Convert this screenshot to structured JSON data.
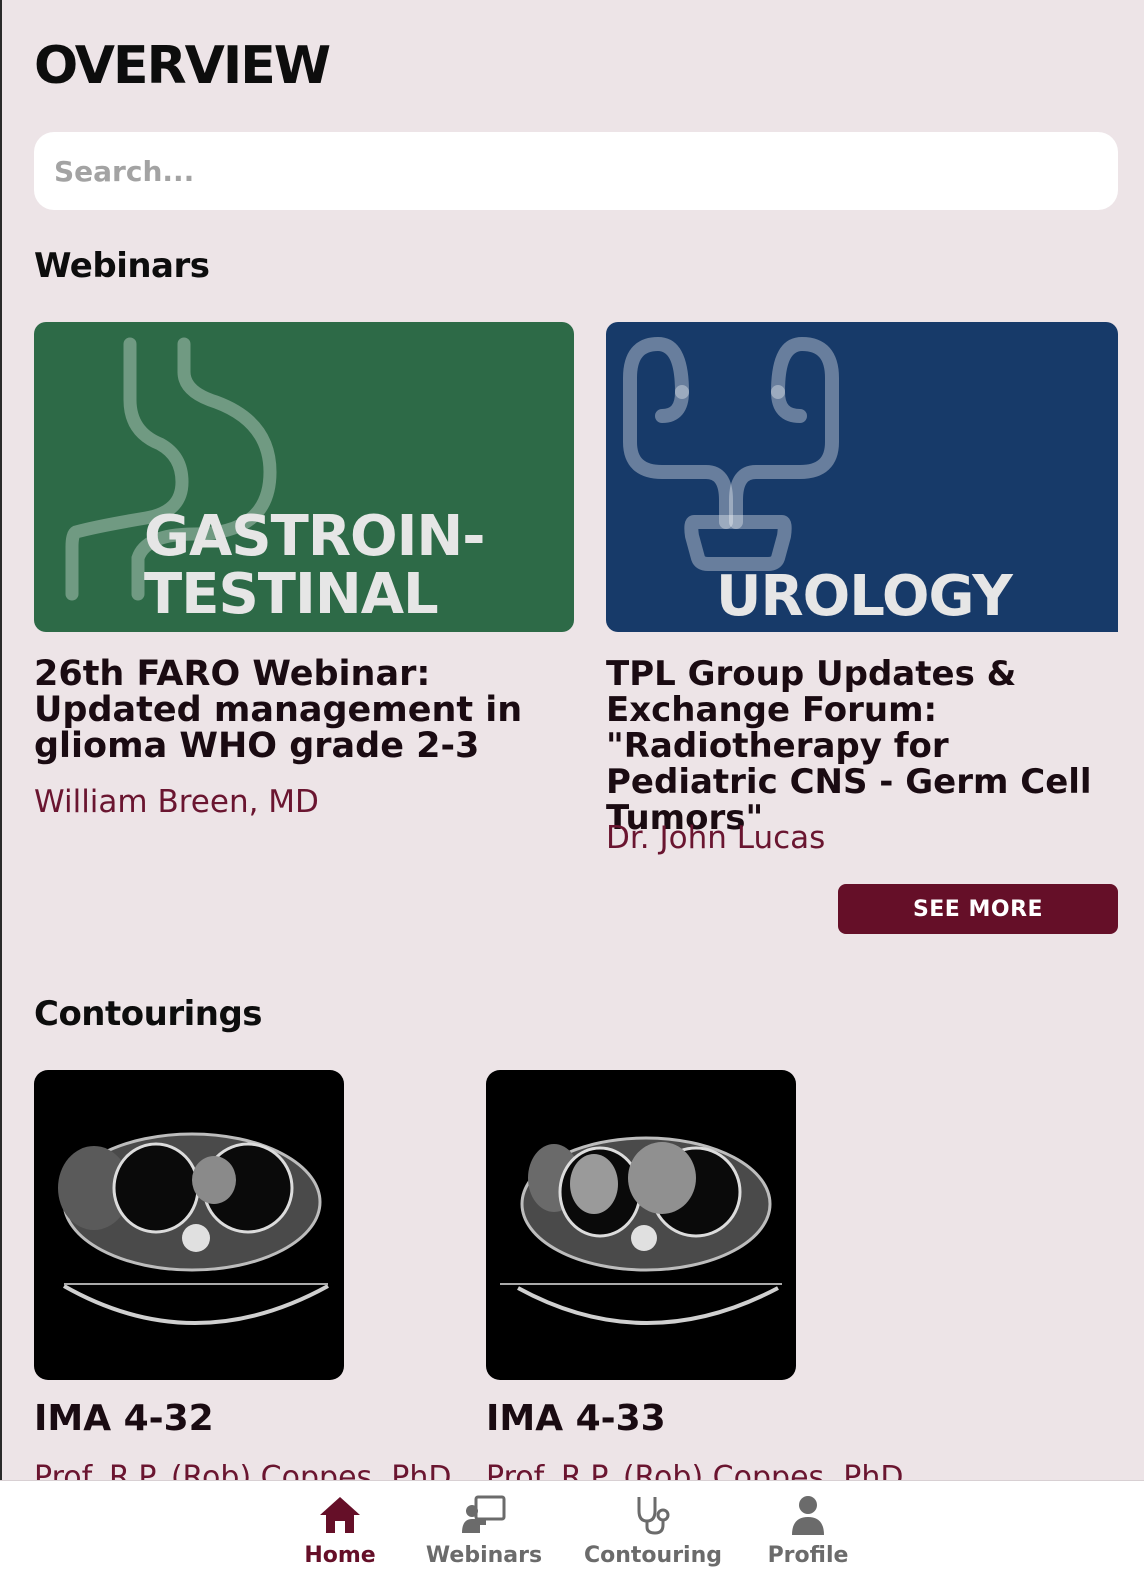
{
  "page": {
    "title": "OVERVIEW"
  },
  "search": {
    "placeholder": "Search..."
  },
  "webinars": {
    "section_title": "Webinars",
    "items": [
      {
        "banner_lines": [
          "GASTROIN-",
          "TESTINAL"
        ],
        "title": "26th FARO Webinar: Updated management in glioma WHO grade 2-3",
        "author": "William Breen, MD"
      },
      {
        "banner_lines": [
          "UROLOGY"
        ],
        "title": "TPL Group Updates & Exchange Forum: \"Radiotherapy for Pediatric CNS - Germ Cell Tumors\"",
        "author": "Dr. John Lucas"
      }
    ],
    "see_more_label": "SEE MORE"
  },
  "contourings": {
    "section_title": "Contourings",
    "items": [
      {
        "title": "IMA 4-32",
        "author": "Prof. R.P. (Rob) Coppes, PhD"
      },
      {
        "title": "IMA 4-33",
        "author": "Prof. R.P. (Rob) Coppes, PhD"
      }
    ]
  },
  "tabbar": {
    "tabs": [
      {
        "label": "Home",
        "icon": "home-icon",
        "active": true
      },
      {
        "label": "Webinars",
        "icon": "webinar-presenter-icon",
        "active": false
      },
      {
        "label": "Contouring",
        "icon": "stethoscope-icon",
        "active": false
      },
      {
        "label": "Profile",
        "icon": "person-icon",
        "active": false
      }
    ]
  },
  "colors": {
    "background": "#ede4e7",
    "accent": "#650f28",
    "author_text": "#6a1530",
    "gastro_banner": "#2d6a47",
    "urology_banner": "#173a69"
  }
}
